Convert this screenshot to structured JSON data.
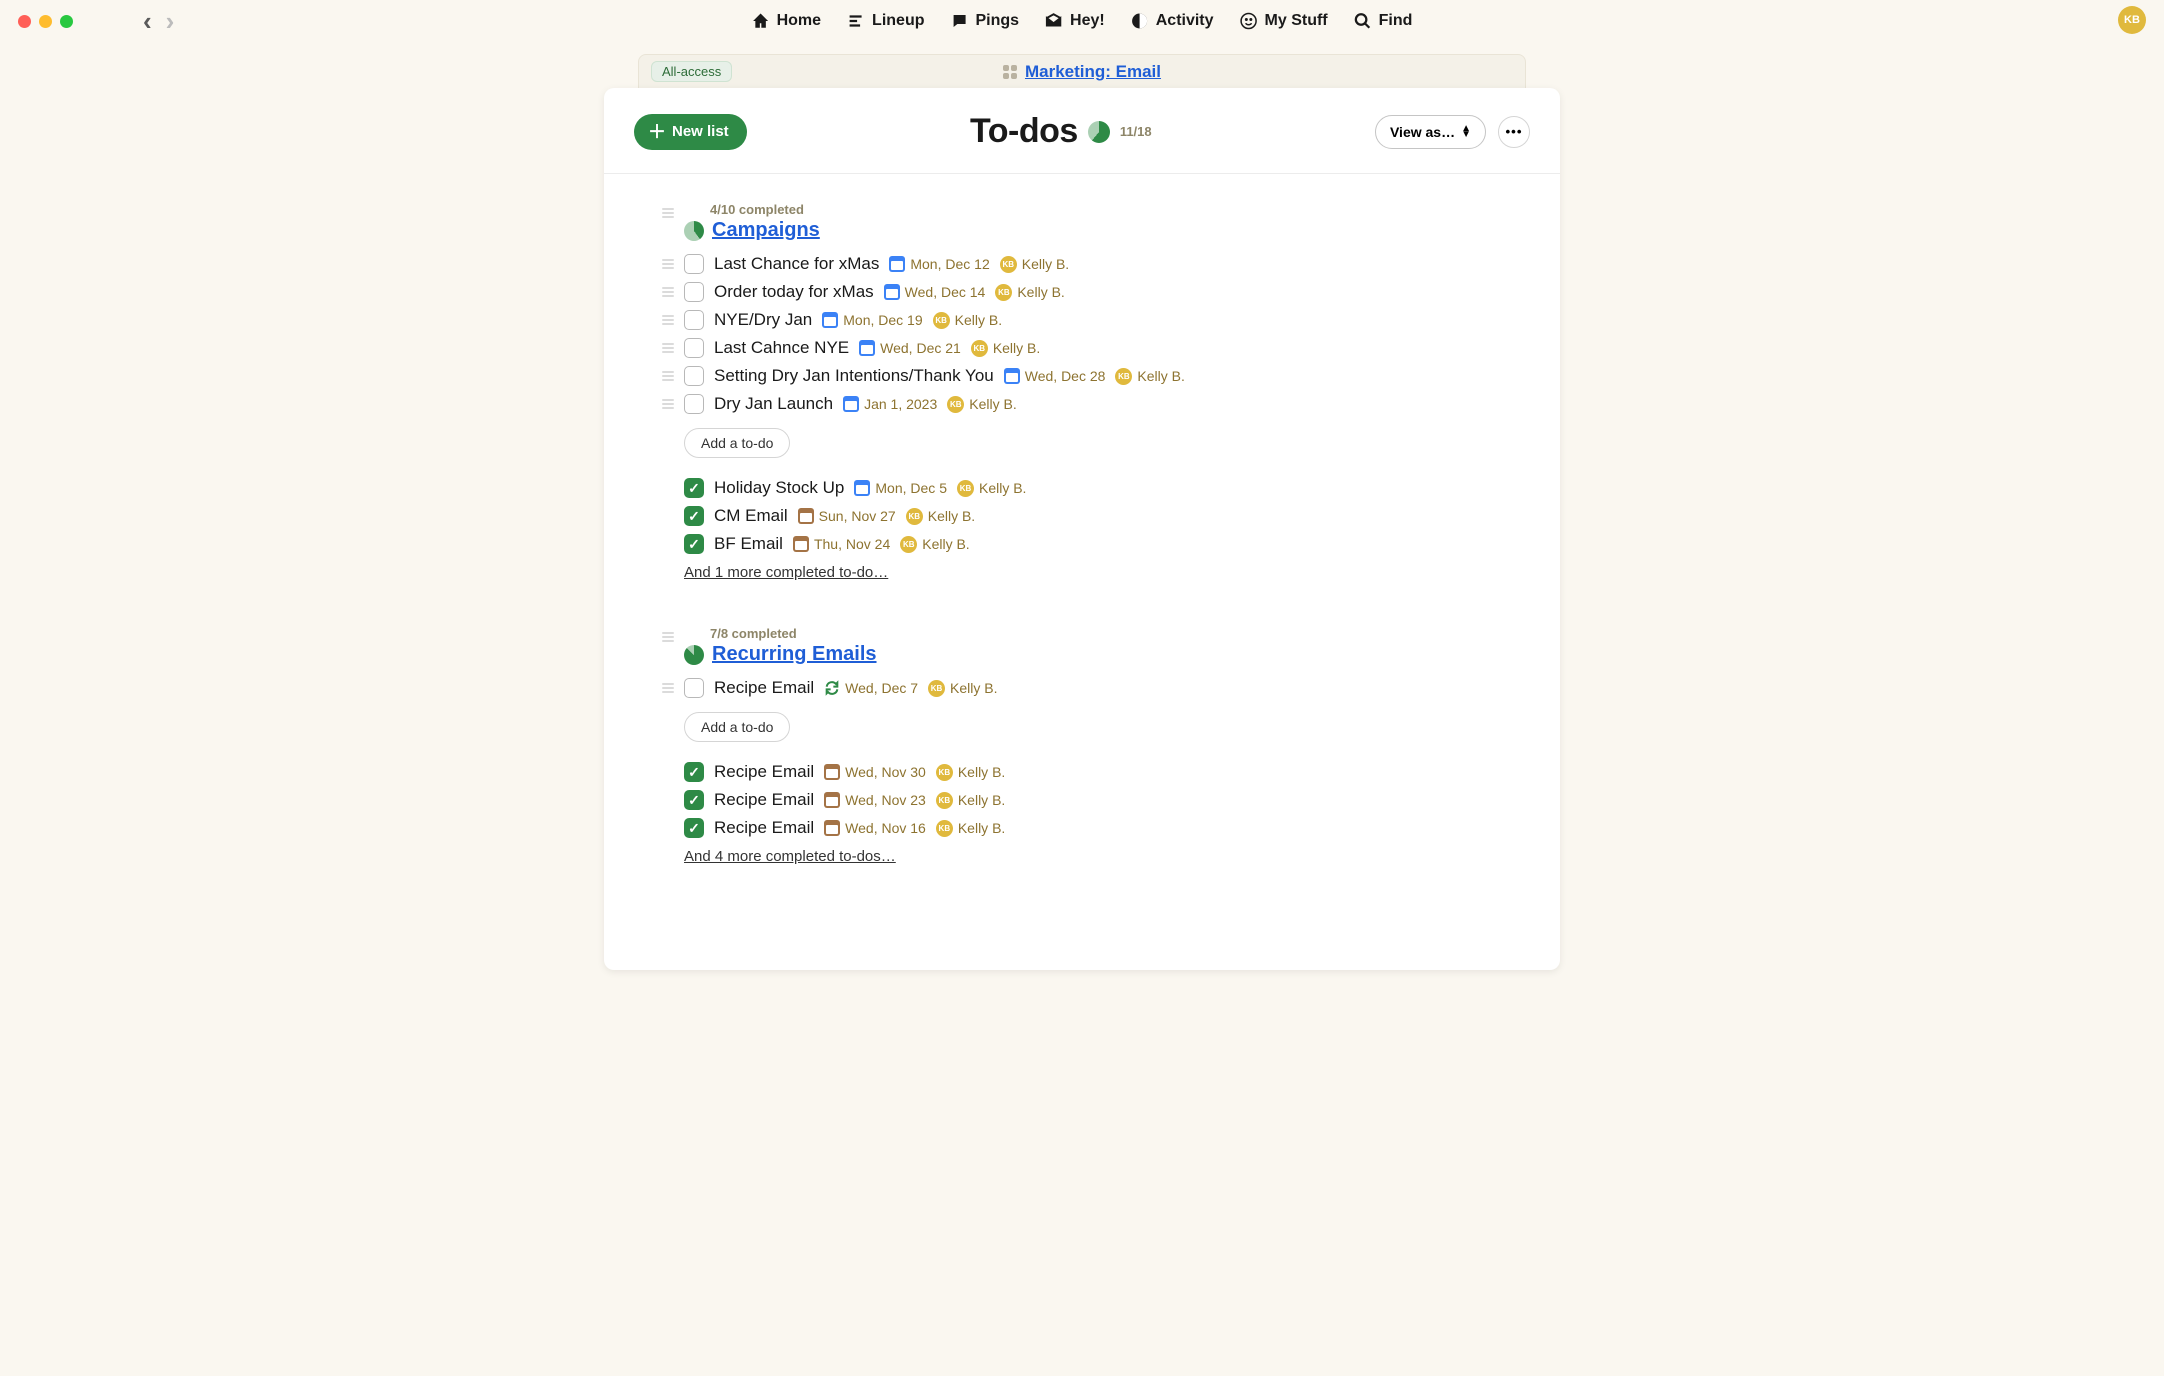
{
  "window": {
    "user_initials": "KB"
  },
  "topnav": {
    "home": "Home",
    "lineup": "Lineup",
    "pings": "Pings",
    "hey": "Hey!",
    "activity": "Activity",
    "mystuff": "My Stuff",
    "find": "Find"
  },
  "tabstrip": {
    "access_label": "All-access",
    "project_link": "Marketing: Email"
  },
  "header": {
    "new_list_label": "New list",
    "title": "To-dos",
    "overall_count": "11/18",
    "overall_ratio": 0.61,
    "view_as_label": "View as…"
  },
  "lists": [
    {
      "id": "campaigns",
      "meta": "4/10 completed",
      "title": "Campaigns",
      "ratio": 0.4,
      "open_todos": [
        {
          "title": "Last Chance for xMas",
          "date": "Mon, Dec 12",
          "date_style": "future",
          "assignee": "Kelly B."
        },
        {
          "title": "Order today for xMas",
          "date": "Wed, Dec 14",
          "date_style": "future",
          "assignee": "Kelly B."
        },
        {
          "title": "NYE/Dry Jan",
          "date": "Mon, Dec 19",
          "date_style": "future",
          "assignee": "Kelly B."
        },
        {
          "title": "Last Cahnce NYE",
          "date": "Wed, Dec 21",
          "date_style": "future",
          "assignee": "Kelly B."
        },
        {
          "title": "Setting Dry Jan Intentions/Thank You",
          "date": "Wed, Dec 28",
          "date_style": "future",
          "assignee": "Kelly B."
        },
        {
          "title": "Dry Jan Launch",
          "date": "Jan 1, 2023",
          "date_style": "future",
          "assignee": "Kelly B."
        }
      ],
      "add_label": "Add a to-do",
      "done_todos": [
        {
          "title": "Holiday Stock Up",
          "date": "Mon, Dec 5",
          "date_style": "future",
          "assignee": "Kelly B."
        },
        {
          "title": "CM Email",
          "date": "Sun, Nov 27",
          "date_style": "past",
          "assignee": "Kelly B."
        },
        {
          "title": "BF Email",
          "date": "Thu, Nov 24",
          "date_style": "past",
          "assignee": "Kelly B."
        }
      ],
      "more_completed": "And 1 more completed to-do…"
    },
    {
      "id": "recurring",
      "meta": "7/8 completed",
      "title": "Recurring Emails",
      "ratio": 0.875,
      "open_todos": [
        {
          "title": "Recipe Email",
          "date": "Wed, Dec 7",
          "date_style": "repeat",
          "assignee": "Kelly B."
        }
      ],
      "add_label": "Add a to-do",
      "done_todos": [
        {
          "title": "Recipe Email",
          "date": "Wed, Nov 30",
          "date_style": "past",
          "assignee": "Kelly B."
        },
        {
          "title": "Recipe Email",
          "date": "Wed, Nov 23",
          "date_style": "past",
          "assignee": "Kelly B."
        },
        {
          "title": "Recipe Email",
          "date": "Wed, Nov 16",
          "date_style": "past",
          "assignee": "Kelly B."
        }
      ],
      "more_completed": "And 4 more completed to-dos…"
    }
  ],
  "avatar_initials": "KB"
}
